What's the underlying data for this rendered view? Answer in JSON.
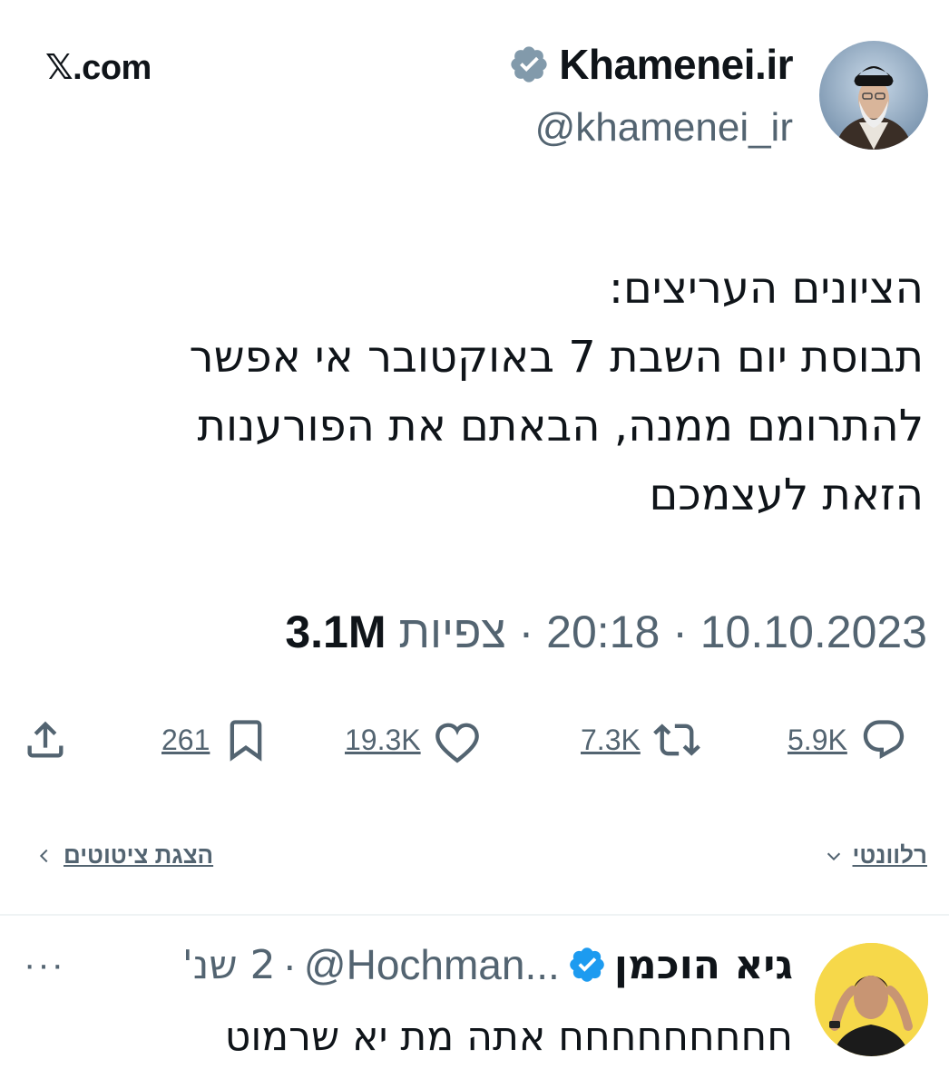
{
  "brand": {
    "x_glyph": "𝕏",
    "text": ".com"
  },
  "author": {
    "name": "Khamenei.ir",
    "handle": "@khamenei_ir",
    "verified_color": "#829aab",
    "avatar_icon": "portrait-avatar"
  },
  "tweet": {
    "text": "הציונים העריצים:\nתבוסת יום השבת 7 באוקטובר אי אפשר\nלהתרומם ממנה, הבאתם את הפורענות\nהזאת לעצמכם",
    "date": "10.10.2023",
    "time": "20:18",
    "views_label": "צפיות",
    "views_count": "3.1M",
    "separator": "·"
  },
  "actions": {
    "replies": "5.9K",
    "retweets": "7.3K",
    "likes": "19.3K",
    "bookmarks": "261"
  },
  "sort": {
    "relevance": "רלוונטי",
    "relevance_icon": "chevron-down-icon",
    "quotes": "הצגת ציטוטים",
    "quotes_icon": "chevron-left-icon"
  },
  "reply": {
    "name": "גיא הוכמן",
    "handle": "@Hochman...",
    "time": "2 שנ'",
    "separator": "·",
    "more": "···",
    "text": "חחחחחחחחח אתה מת יא שרמוט",
    "verified_color": "#1d9bf0"
  }
}
